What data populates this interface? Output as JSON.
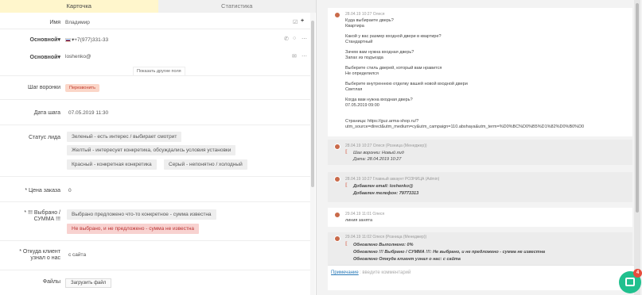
{
  "tabs": {
    "card": "Карточка",
    "stats": "Статистика"
  },
  "fields": {
    "name_label": "Имя",
    "name_value": "Владимир",
    "phone_label": "Основной",
    "phone_value": "+7(977)331-33",
    "email_label": "Основной",
    "email_value": "loshenko@",
    "show_more": "Показать другие поля",
    "funnel_label": "Шаг воронки",
    "funnel_value": "Перезвонить",
    "date_label": "Дата шага",
    "date_value": "07.05.2019 11:30",
    "status_label": "Статус лида",
    "status_options": [
      "Зеленый - есть интерес / выбирает смотрит",
      "Желтый - интересует конкретика, обсуждались условия установки",
      "Красный - конкретная конкретика",
      "Серый - непонятно / холодный"
    ],
    "price_label": "* Цена заказа",
    "price_value": "0",
    "chosen_label_1": "* !!! Выбрано /",
    "chosen_label_2": "СУММА !!!",
    "chosen_options": [
      "Выбрано предложено что-то конкретное - сумма известна",
      "Не выбрано, и не предложено - сумма не известна"
    ],
    "source_label_1": "* Откуда клиент",
    "source_label_2": "узнал о нас",
    "source_value": "с сайта",
    "files_label": "Файлы",
    "upload_label": "Загрузить файл"
  },
  "feed": {
    "m1": {
      "meta": "28.04.19 10:27 Олеся",
      "lines": [
        "Куда выбираете дверь?",
        "Квартира",
        "",
        "Какой у вас размер входной двери в квартире?",
        "Стандартный",
        "",
        "Зачем вам нужна входная дверь?",
        "Запах из подъезда",
        "",
        "Выберите стиль дверей, который вам нравится",
        "Не определился",
        "",
        "Выберите внутреннюю отделку вашей новой входной двери",
        "Светлая",
        "",
        "Когда вам нужна входная дверь?",
        "07.05.2019 09:00",
        "",
        "",
        "Страница: https://guz.arma-shop.ru/?",
        "utm_source=direct&utm_medium=cy&utm_campaign=110.abshaya&utm_term=%D0%BC%D0%B5%D1%82%D0%B0%D0"
      ]
    },
    "m2": {
      "meta": "28.04.19 10:27 Олеся (Розница (Менеджер))",
      "l1": "Шаг воронки: Новый лид",
      "l2": "Дата: 28.04.2019 10:27"
    },
    "m3": {
      "meta": "28.04.19 10:27 Главный аккаунт РОЗНИЦА (Admin)",
      "l1": "Добавлен email: loshenko@",
      "l2": "Добавлен телефон: 79773313"
    },
    "m4": {
      "meta": "29.04.19 11:01 Олеся",
      "l1": "линия занята"
    },
    "m5": {
      "meta": "29.04.19 11:02 Олеся (Розница (Менеджер))",
      "l1": "Обновлено Выполнено: 0%",
      "l2": "Обновлено !!! Выбрано / СУММА !!!: Не выбрано, и не предложено - сумма не известна",
      "l3": "Обновлено Откуда клиент узнал о нас: с сайта"
    }
  },
  "comment": {
    "link": "Примечание",
    "placeholder": ": введите комментарий"
  },
  "chat": {
    "count": "4"
  },
  "colors": {
    "accent": "#20c08e",
    "badge": "#e74c3c",
    "tab_active": "#fff6cc"
  }
}
